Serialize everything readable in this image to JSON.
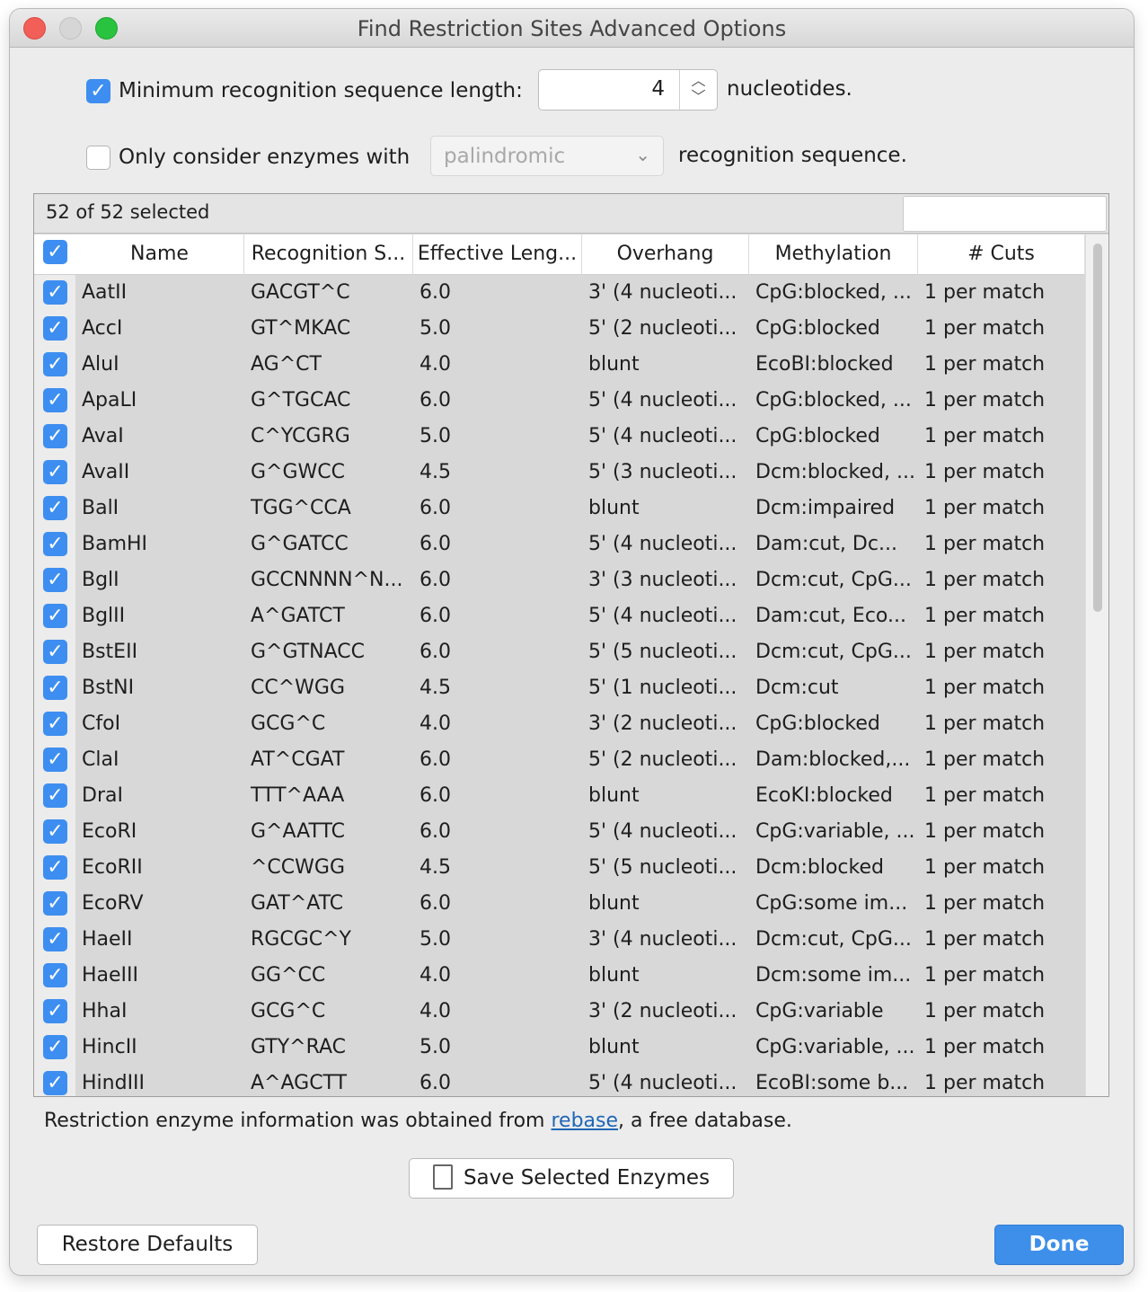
{
  "window": {
    "title": "Find Restriction Sites Advanced Options"
  },
  "options": {
    "min_length_label": "Minimum recognition sequence length:",
    "min_length_checked": true,
    "min_length_value": "4",
    "min_length_unit": "nucleotides.",
    "only_consider_label": "Only consider enzymes with",
    "only_consider_checked": false,
    "only_consider_select_value": "palindromic",
    "only_consider_suffix": "recognition sequence."
  },
  "table": {
    "selected_count": "52 of 52 selected",
    "search_placeholder": "",
    "columns": [
      "Name",
      "Recognition S...",
      "Effective Leng...",
      "Overhang",
      "Methylation",
      "# Cuts"
    ],
    "rows": [
      {
        "name": "AatII",
        "rec": "GACGT^C",
        "eff": "6.0",
        "ovh": "3' (4 nucleoti...",
        "meth": "CpG:blocked, ...",
        "cuts": "1 per match"
      },
      {
        "name": "AccI",
        "rec": "GT^MKAC",
        "eff": "5.0",
        "ovh": "5' (2 nucleoti...",
        "meth": "CpG:blocked",
        "cuts": "1 per match"
      },
      {
        "name": "AluI",
        "rec": "AG^CT",
        "eff": "4.0",
        "ovh": "blunt",
        "meth": "EcoBI:blocked",
        "cuts": "1 per match"
      },
      {
        "name": "ApaLI",
        "rec": "G^TGCAC",
        "eff": "6.0",
        "ovh": "5' (4 nucleoti...",
        "meth": "CpG:blocked, ...",
        "cuts": "1 per match"
      },
      {
        "name": "AvaI",
        "rec": "C^YCGRG",
        "eff": "5.0",
        "ovh": "5' (4 nucleoti...",
        "meth": "CpG:blocked",
        "cuts": "1 per match"
      },
      {
        "name": "AvaII",
        "rec": "G^GWCC",
        "eff": "4.5",
        "ovh": "5' (3 nucleoti...",
        "meth": "Dcm:blocked, ...",
        "cuts": "1 per match"
      },
      {
        "name": "BalI",
        "rec": "TGG^CCA",
        "eff": "6.0",
        "ovh": "blunt",
        "meth": "Dcm:impaired",
        "cuts": "1 per match"
      },
      {
        "name": "BamHI",
        "rec": "G^GATCC",
        "eff": "6.0",
        "ovh": "5' (4 nucleoti...",
        "meth": "Dam:cut, Dc...",
        "cuts": "1 per match"
      },
      {
        "name": "BglI",
        "rec": "GCCNNNN^N...",
        "eff": "6.0",
        "ovh": "3' (3 nucleoti...",
        "meth": "Dcm:cut, CpG...",
        "cuts": "1 per match"
      },
      {
        "name": "BglII",
        "rec": "A^GATCT",
        "eff": "6.0",
        "ovh": "5' (4 nucleoti...",
        "meth": "Dam:cut, Eco...",
        "cuts": "1 per match"
      },
      {
        "name": "BstEII",
        "rec": "G^GTNACC",
        "eff": "6.0",
        "ovh": "5' (5 nucleoti...",
        "meth": "Dcm:cut, CpG...",
        "cuts": "1 per match"
      },
      {
        "name": "BstNI",
        "rec": "CC^WGG",
        "eff": "4.5",
        "ovh": "5' (1 nucleoti...",
        "meth": "Dcm:cut",
        "cuts": "1 per match"
      },
      {
        "name": "CfoI",
        "rec": "GCG^C",
        "eff": "4.0",
        "ovh": "3' (2 nucleoti...",
        "meth": "CpG:blocked",
        "cuts": "1 per match"
      },
      {
        "name": "ClaI",
        "rec": "AT^CGAT",
        "eff": "6.0",
        "ovh": "5' (2 nucleoti...",
        "meth": "Dam:blocked,...",
        "cuts": "1 per match"
      },
      {
        "name": "DraI",
        "rec": "TTT^AAA",
        "eff": "6.0",
        "ovh": "blunt",
        "meth": "EcoKI:blocked",
        "cuts": "1 per match"
      },
      {
        "name": "EcoRI",
        "rec": "G^AATTC",
        "eff": "6.0",
        "ovh": "5' (4 nucleoti...",
        "meth": "CpG:variable, ...",
        "cuts": "1 per match"
      },
      {
        "name": "EcoRII",
        "rec": "^CCWGG",
        "eff": "4.5",
        "ovh": "5' (5 nucleoti...",
        "meth": "Dcm:blocked",
        "cuts": "1 per match"
      },
      {
        "name": "EcoRV",
        "rec": "GAT^ATC",
        "eff": "6.0",
        "ovh": "blunt",
        "meth": "CpG:some im...",
        "cuts": "1 per match"
      },
      {
        "name": "HaeII",
        "rec": "RGCGC^Y",
        "eff": "5.0",
        "ovh": "3' (4 nucleoti...",
        "meth": "Dcm:cut, CpG...",
        "cuts": "1 per match"
      },
      {
        "name": "HaeIII",
        "rec": "GG^CC",
        "eff": "4.0",
        "ovh": "blunt",
        "meth": "Dcm:some im...",
        "cuts": "1 per match"
      },
      {
        "name": "HhaI",
        "rec": "GCG^C",
        "eff": "4.0",
        "ovh": "3' (2 nucleoti...",
        "meth": "CpG:variable",
        "cuts": "1 per match"
      },
      {
        "name": "HincII",
        "rec": "GTY^RAC",
        "eff": "5.0",
        "ovh": "blunt",
        "meth": "CpG:variable, ...",
        "cuts": "1 per match"
      },
      {
        "name": "HindIII",
        "rec": "A^AGCTT",
        "eff": "6.0",
        "ovh": "5' (4 nucleoti...",
        "meth": "EcoBI:some b...",
        "cuts": "1 per match"
      }
    ]
  },
  "footer": {
    "note_prefix": "Restriction enzyme information was obtained from ",
    "note_link": "rebase",
    "note_suffix": ", a free database.",
    "save_button": "Save Selected Enzymes",
    "restore_button": "Restore Defaults",
    "done_button": "Done"
  }
}
